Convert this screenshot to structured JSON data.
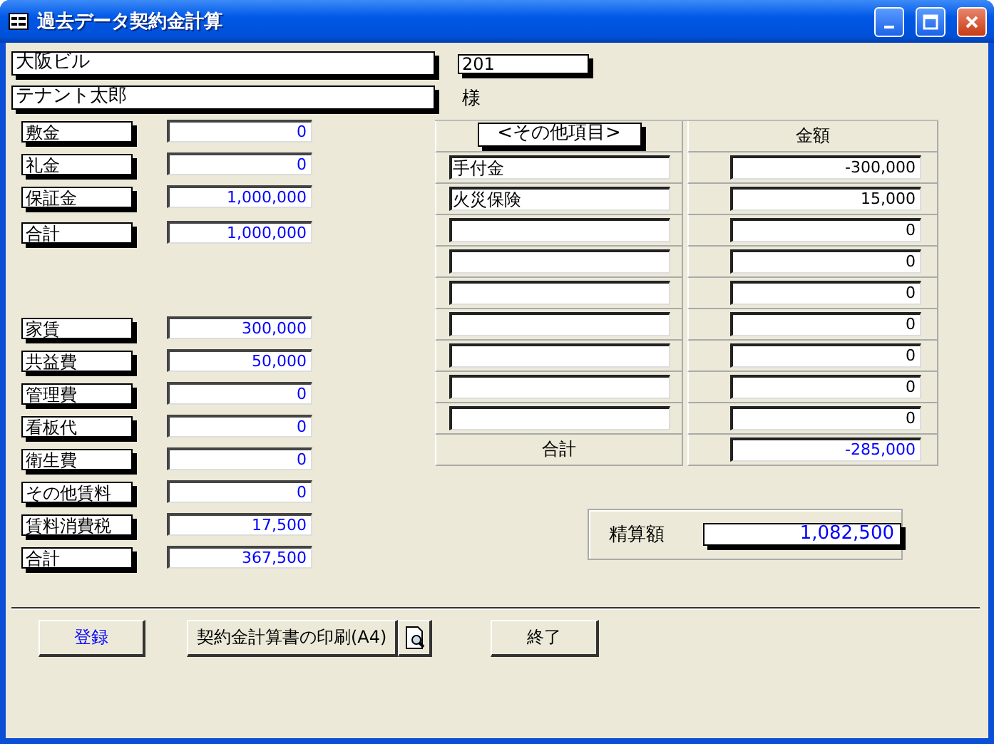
{
  "window": {
    "title": "過去データ契約金計算"
  },
  "property": {
    "building": "大阪ビル",
    "room": "201"
  },
  "tenant": {
    "name": "テナント太郎",
    "honorific": "様"
  },
  "deposits": [
    {
      "label": "敷金",
      "value": "0"
    },
    {
      "label": "礼金",
      "value": "0"
    },
    {
      "label": "保証金",
      "value": "1,000,000"
    }
  ],
  "deposit_total": {
    "label": "合計",
    "value": "1,000,000"
  },
  "monthly": [
    {
      "label": "家賃",
      "value": "300,000"
    },
    {
      "label": "共益費",
      "value": "50,000"
    },
    {
      "label": "管理費",
      "value": "0"
    },
    {
      "label": "看板代",
      "value": "0"
    },
    {
      "label": "衛生費",
      "value": "0"
    },
    {
      "label": "その他賃料",
      "value": "0"
    },
    {
      "label": "賃料消費税",
      "value": "17,500"
    }
  ],
  "monthly_total": {
    "label": "合計",
    "value": "367,500"
  },
  "other_items": {
    "name_header": "<その他項目>",
    "amount_header": "金額",
    "rows": [
      {
        "name": "手付金",
        "amount": "-300,000"
      },
      {
        "name": "火災保険",
        "amount": "15,000"
      },
      {
        "amount": "0"
      },
      {
        "amount": "0"
      },
      {
        "amount": "0"
      },
      {
        "amount": "0"
      },
      {
        "amount": "0"
      },
      {
        "amount": "0"
      },
      {
        "amount": "0"
      }
    ],
    "total_label": "合計",
    "total": "-285,000"
  },
  "settlement": {
    "label": "精算額",
    "value": "1,082,500"
  },
  "buttons": [
    {
      "kind": "primary",
      "label": "登録"
    },
    {
      "kind": "plain",
      "label": "契約金計算書の印刷(A4)"
    },
    {
      "kind": "preview"
    },
    {
      "kind": "plain",
      "label": "終了"
    }
  ]
}
